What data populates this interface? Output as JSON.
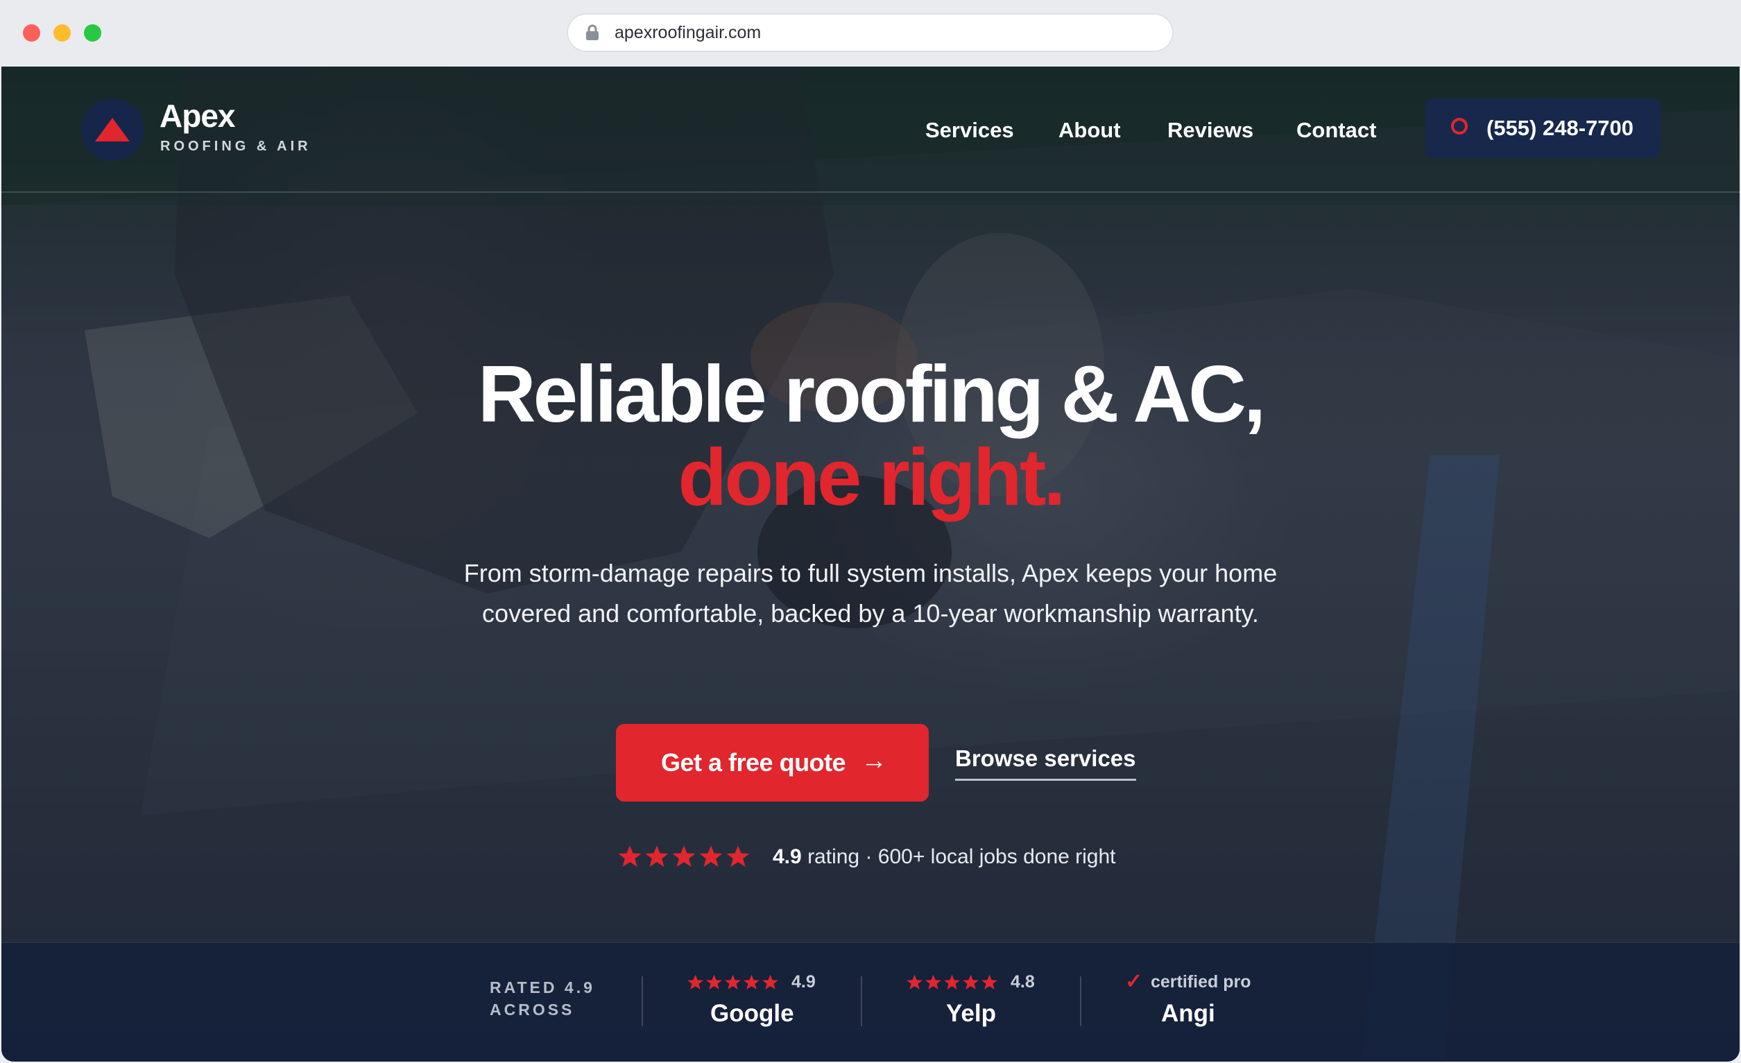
{
  "browser": {
    "url": "apexroofingair.com"
  },
  "nav": {
    "brand_name": "Apex",
    "brand_tagline": "ROOFING & AIR",
    "links": [
      "Services",
      "About",
      "Reviews",
      "Contact"
    ],
    "phone": "(555) 248-7700"
  },
  "hero": {
    "title": "Reliable roofing & AC,",
    "title_accent": "done right.",
    "subtitle": "From storm-damage repairs to full system installs, Apex keeps your home covered and comfortable, backed by a 10-year workmanship warranty.",
    "cta_primary": "Get a free quote",
    "cta_arrow": "→",
    "cta_secondary": "Browse services",
    "rating_value": "4.9",
    "rating_rest": "rating · 600+ local jobs done right",
    "rating_stars": 5
  },
  "trust": {
    "label_line1": "RATED 4.9",
    "label_line2": "ACROSS",
    "platforms": [
      {
        "name": "Google",
        "score": "4.9",
        "stars": 5
      },
      {
        "name": "Yelp",
        "score": "4.8",
        "stars": 5
      },
      {
        "name": "Angi",
        "badge": "certified pro"
      }
    ]
  },
  "colors": {
    "accent": "#e1262d",
    "navy": "#17284c"
  },
  "icons": [
    "lock-icon",
    "logo-triangle-icon",
    "phone-ring-icon",
    "star-icon",
    "arrow-right-icon",
    "check-icon"
  ]
}
